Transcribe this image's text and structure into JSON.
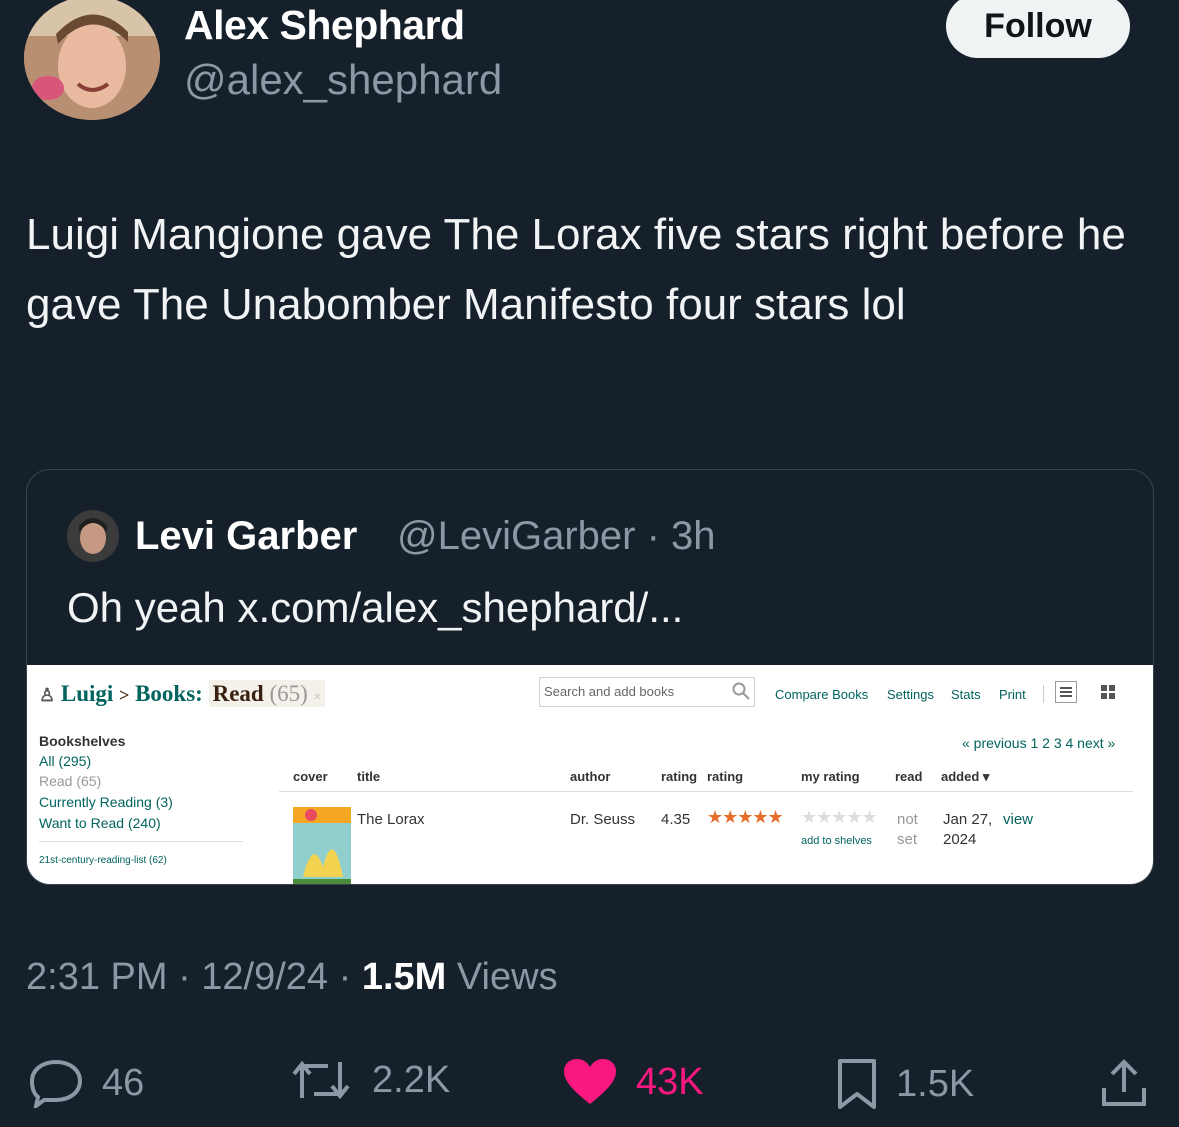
{
  "author": {
    "name": "Alex Shephard",
    "handle": "@alex_shephard",
    "follow_label": "Follow"
  },
  "tweet": {
    "text": "Luigi Mangione gave The Lorax five stars right before he gave The Unabomber Manifesto four stars lol"
  },
  "quote": {
    "name": "Levi Garber",
    "handle_time": "@LeviGarber · 3h",
    "text": "Oh yeah x.com/alex_shephard/..."
  },
  "goodreads": {
    "crumb_user": "Luigi",
    "crumb_sep": ">",
    "crumb_books": "Books:",
    "crumb_shelf": "Read",
    "crumb_count": "(65)",
    "crumb_x": "×",
    "search_placeholder": "Search and add books",
    "links": [
      "Compare Books",
      "Settings",
      "Stats",
      "Print"
    ],
    "bookshelves_title": "Bookshelves",
    "shelves": [
      "All (295)",
      "Read (65)",
      "Currently Reading (3)",
      "Want to Read (240)"
    ],
    "list_shelf": "21st-century-reading-list (62)",
    "pager": "« previous 1 2 3 4 next »",
    "columns": [
      "cover",
      "title",
      "author",
      "rating",
      "rating",
      "my rating",
      "read",
      "added ▾"
    ],
    "row": {
      "title": "The Lorax",
      "author": "Dr. Seuss",
      "avg_rating": "4.35",
      "stars": "★★★★★",
      "my_stars": "★★★★★",
      "add_to_shelves": "add to shelves",
      "read_1": "not",
      "read_2": "set",
      "added_1": "Jan 27,",
      "added_2": "2024",
      "view": "view"
    }
  },
  "meta": {
    "time": "2:31 PM · 12/9/24 · ",
    "views_count": "1.5M",
    "views_label": " Views"
  },
  "actions": {
    "replies": "46",
    "reposts": "2.2K",
    "likes": "43K",
    "bookmarks": "1.5K"
  },
  "colors": {
    "background": "#15202b",
    "like": "#f91880",
    "muted": "#8b98a5"
  }
}
